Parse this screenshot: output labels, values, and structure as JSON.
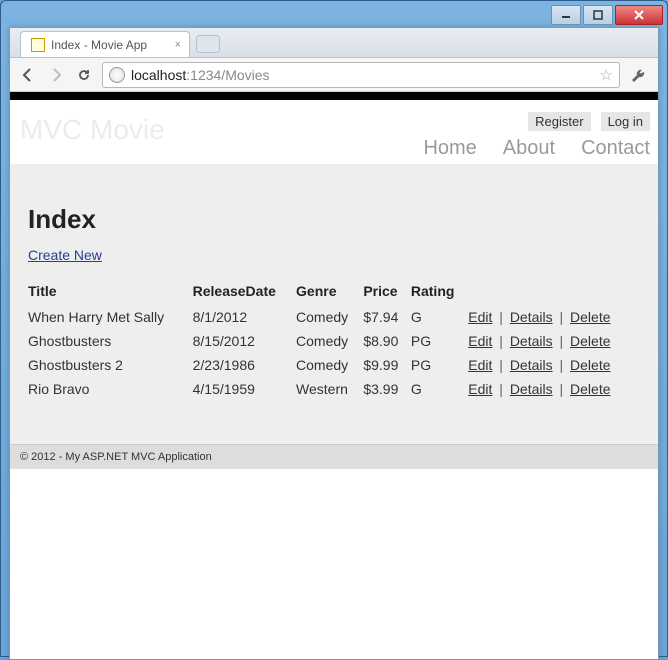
{
  "window": {
    "tab_title": "Index - Movie App"
  },
  "browser": {
    "url_host": "localhost",
    "url_rest": ":1234/Movies"
  },
  "header": {
    "brand": "MVC Movie",
    "account": {
      "register": "Register",
      "login": "Log in"
    },
    "nav": {
      "home": "Home",
      "about": "About",
      "contact": "Contact"
    }
  },
  "page": {
    "title": "Index",
    "create_label": "Create New",
    "columns": {
      "title": "Title",
      "release": "ReleaseDate",
      "genre": "Genre",
      "price": "Price",
      "rating": "Rating"
    },
    "actions": {
      "edit": "Edit",
      "details": "Details",
      "delete": "Delete"
    },
    "rows": [
      {
        "title": "When Harry Met Sally",
        "release": "8/1/2012",
        "genre": "Comedy",
        "price": "$7.94",
        "rating": "G"
      },
      {
        "title": "Ghostbusters",
        "release": "8/15/2012",
        "genre": "Comedy",
        "price": "$8.90",
        "rating": "PG"
      },
      {
        "title": "Ghostbusters 2",
        "release": "2/23/1986",
        "genre": "Comedy",
        "price": "$9.99",
        "rating": "PG"
      },
      {
        "title": "Rio Bravo",
        "release": "4/15/1959",
        "genre": "Western",
        "price": "$3.99",
        "rating": "G"
      }
    ]
  },
  "footer": {
    "text": "© 2012 - My ASP.NET MVC Application"
  }
}
